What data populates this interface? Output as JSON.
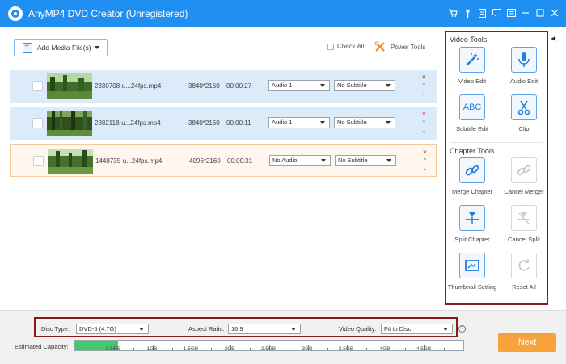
{
  "window": {
    "title": "AnyMP4 DVD Creator (Unregistered)"
  },
  "toolbar": {
    "add_media_label": "Add Media File(s)",
    "check_all_label": "Check All",
    "power_tools_label": "Power Tools"
  },
  "rows": [
    {
      "filename": "2330708-u...24fps.mp4",
      "resolution": "3840*2160",
      "duration": "00:00:27",
      "audio": "Audio 1",
      "subtitle": "No Subtitle"
    },
    {
      "filename": "2882118-u...24fps.mp4",
      "resolution": "3840*2160",
      "duration": "00:00:11",
      "audio": "Audio 1",
      "subtitle": "No Subtitle"
    },
    {
      "filename": "1448735-u...24fps.mp4",
      "resolution": "4096*2160",
      "duration": "00:00:31",
      "audio": "No Audio",
      "subtitle": "No Subtitle"
    }
  ],
  "row_controls": {
    "delete": "×",
    "up": "⌃",
    "down": "⌄"
  },
  "tools": {
    "video_title": "Video Tools",
    "chapter_title": "Chapter Tools",
    "video": [
      "Video Edit",
      "Audio Edit",
      "Subtitle Edit",
      "Clip"
    ],
    "subtitle_icon_text": "ABC",
    "chapter": [
      "Merge Chapter",
      "Cancel Merger",
      "Split Chapter",
      "Cancel Split",
      "Thumbnail Setting",
      "Reset All"
    ]
  },
  "bottom": {
    "disc_type_label": "Disc Type:",
    "disc_type_value": "DVD-5 (4.7G)",
    "aspect_label": "Aspect Ratio:",
    "aspect_value": "16:9",
    "quality_label": "Video Quality:",
    "quality_value": "Fit to Disc",
    "help": "?",
    "capacity_label": "Estimated Capacity:",
    "capacity_fraction": 0.011,
    "ticks": [
      "0.5GB",
      "1GB",
      "1.5GB",
      "2GB",
      "2.5GB",
      "3GB",
      "3.5GB",
      "4GB",
      "4.5GB"
    ],
    "next_label": "Next"
  },
  "colors": {
    "accent": "#1f8ff1",
    "next": "#f7a23b",
    "highlight_border": "#8b1a1a",
    "capacity_fill": "#41c96b"
  }
}
